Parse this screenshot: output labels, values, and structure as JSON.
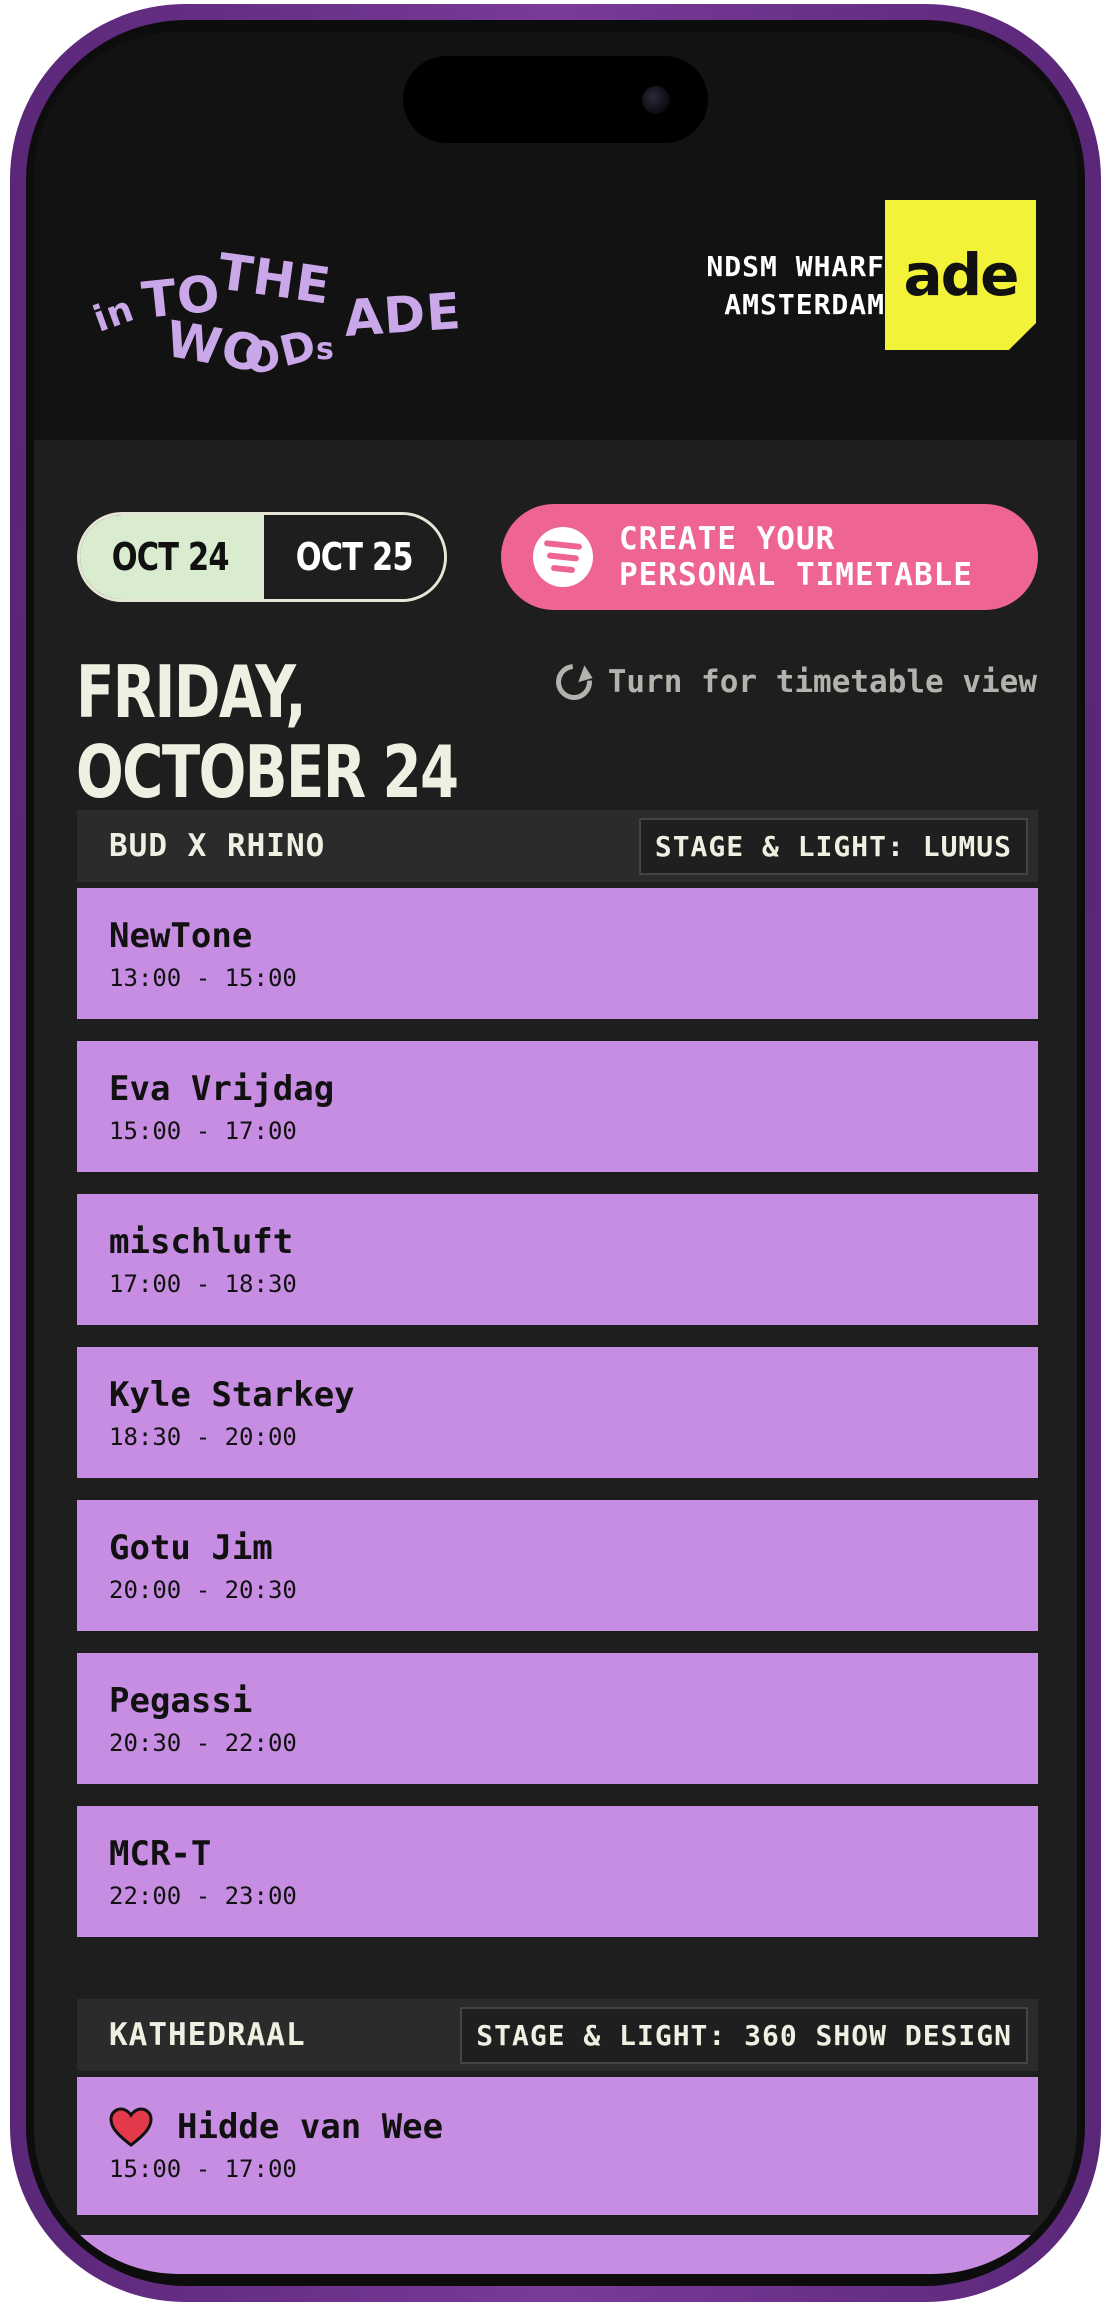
{
  "header": {
    "logo_text": "INTO THE WOODS ADE",
    "venue_line1": "NDSM WHARF",
    "venue_line2": "AMSTERDAM",
    "badge_text": "ade"
  },
  "date_toggle": {
    "options": [
      "OCT 24",
      "OCT 25"
    ],
    "selected": "OCT 24"
  },
  "spotify_cta": {
    "label": "CREATE YOUR\nPERSONAL TIMETABLE",
    "icon": "spotify-icon",
    "color": "#ee6591"
  },
  "day_heading": "FRIDAY,\nOCTOBER 24",
  "rotate_hint": "Turn for timetable view",
  "stages": [
    {
      "name": "BUD X RHINO",
      "credit": "STAGE & LIGHT: LUMUS",
      "sets": [
        {
          "artist": "NewTone",
          "time": "13:00 - 15:00"
        },
        {
          "artist": "Eva Vrijdag",
          "time": "15:00 - 17:00"
        },
        {
          "artist": "mischluft",
          "time": "17:00 - 18:30"
        },
        {
          "artist": "Kyle Starkey",
          "time": "18:30 - 20:00"
        },
        {
          "artist": "Gotu Jim",
          "time": "20:00 - 20:30"
        },
        {
          "artist": "Pegassi",
          "time": "20:30 - 22:00"
        },
        {
          "artist": "MCR-T",
          "time": "22:00 - 23:00"
        }
      ]
    },
    {
      "name": "KATHEDRAAL",
      "credit": "STAGE & LIGHT: 360 SHOW DESIGN",
      "sets": [
        {
          "artist": "Hidde van Wee",
          "time": "15:00 - 17:00",
          "favorited": true
        }
      ]
    }
  ],
  "colors": {
    "set_card": "#c78de3",
    "background": "#1e1e1e",
    "badge": "#f2f238",
    "heart": "#e23a4a"
  }
}
